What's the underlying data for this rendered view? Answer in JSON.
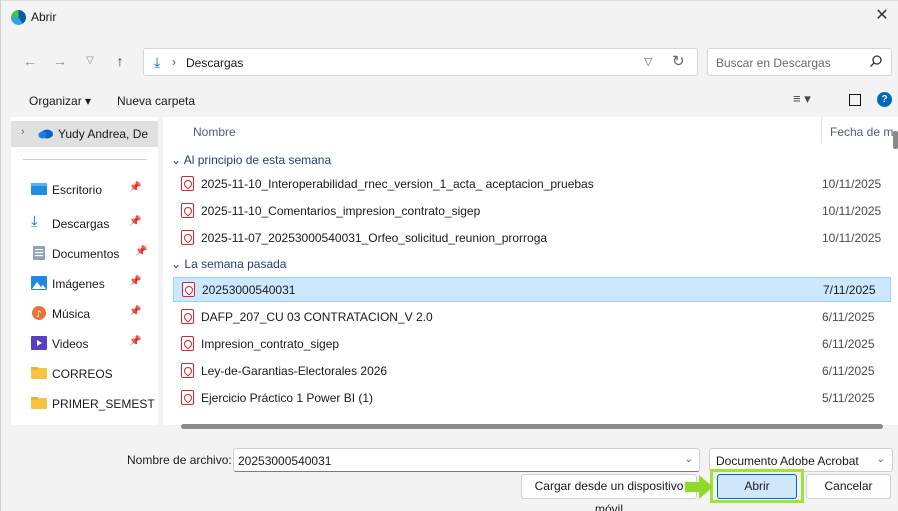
{
  "window": {
    "title": "Abrir",
    "close_icon": "close-icon"
  },
  "address": {
    "path_segment": "Descargas",
    "search_placeholder": "Buscar en Descargas"
  },
  "toolbar": {
    "organize_label": "Organizar ▾",
    "new_folder_label": "Nueva carpeta"
  },
  "sidebar": {
    "top_item": "Yudy Andrea, De",
    "items": [
      {
        "label": "Escritorio",
        "icon": "desktop-icon",
        "pinned": true
      },
      {
        "label": "Descargas",
        "icon": "download-icon",
        "pinned": true
      },
      {
        "label": "Documentos",
        "icon": "documents-icon",
        "pinned": true
      },
      {
        "label": "Imágenes",
        "icon": "pictures-icon",
        "pinned": true
      },
      {
        "label": "Música",
        "icon": "music-icon",
        "pinned": true
      },
      {
        "label": "Videos",
        "icon": "videos-icon",
        "pinned": true
      },
      {
        "label": "CORREOS",
        "icon": "folder-icon",
        "pinned": false
      },
      {
        "label": "PRIMER_SEMEST",
        "icon": "folder-icon",
        "pinned": false
      }
    ]
  },
  "files": {
    "col_name": "Nombre",
    "col_date": "Fecha de m",
    "groups": [
      {
        "label": "Al principio de esta semana",
        "rows": [
          {
            "name": "2025-11-10_Interoperabilidad_rnec_version_1_acta_ aceptacion_pruebas",
            "date": "10/11/2025"
          },
          {
            "name": "2025-11-10_Comentarios_impresion_contrato_sigep",
            "date": "10/11/2025"
          },
          {
            "name": "2025-11-07_20253000540031_Orfeo_solicitud_reunion_prorroga",
            "date": "10/11/2025"
          }
        ]
      },
      {
        "label": "La semana pasada",
        "rows": [
          {
            "name": "20253000540031",
            "date": "7/11/2025",
            "selected": true
          },
          {
            "name": "DAFP_207_CU 03 CONTRATACION_V 2.0",
            "date": "6/11/2025"
          },
          {
            "name": "Impresion_contrato_sigep",
            "date": "6/11/2025"
          },
          {
            "name": "Ley-de-Garantias-Electorales 2026",
            "date": "6/11/2025"
          },
          {
            "name": "Ejercicio Práctico 1 Power BI (1)",
            "date": "5/11/2025"
          }
        ]
      }
    ]
  },
  "bottom": {
    "filename_label": "Nombre de archivo:",
    "filename_value": "20253000540031",
    "filetype_value": "Documento Adobe Acrobat",
    "upload_label": "Cargar desde un dispositivo móvil",
    "open_label": "Abrir",
    "cancel_label": "Cancelar"
  },
  "colors": {
    "accent": "#0067c0",
    "selection": "#cce8ff",
    "highlight": "#9fe23a",
    "pdf_red": "#d0282e"
  }
}
